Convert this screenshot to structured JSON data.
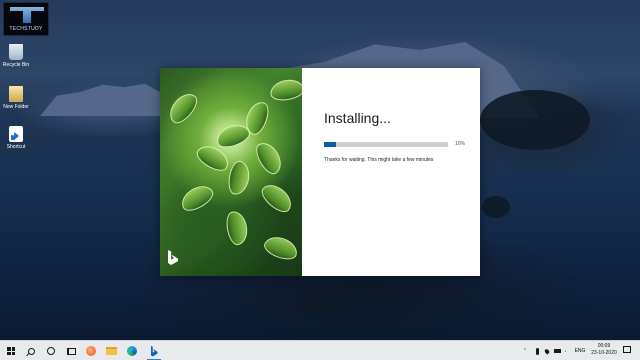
{
  "desktop": {
    "logo_text": "TECHSTUDY",
    "icons": [
      {
        "label": "Recycle Bin",
        "icon": "recycle-bin-icon"
      },
      {
        "label": "New Folder",
        "icon": "folder-icon"
      },
      {
        "label": "Shortcut",
        "icon": "shortcut-icon"
      }
    ]
  },
  "installer": {
    "title": "Installing...",
    "progress_percent_label": "10%",
    "progress_value": 0.1,
    "message": "Thanks for waiting. This might take a few minutes",
    "brand_icon": "bing-icon",
    "accent_color": "#0a5ea8"
  },
  "taskbar": {
    "apps": [
      {
        "name": "start-icon"
      },
      {
        "name": "search-icon"
      },
      {
        "name": "cortana-icon"
      },
      {
        "name": "task-view-icon"
      },
      {
        "name": "app-icon"
      },
      {
        "name": "file-explorer-icon"
      },
      {
        "name": "edge-icon"
      },
      {
        "name": "bing-icon",
        "active": true
      }
    ],
    "language": "ENG",
    "time": "00:09",
    "date": "23-10-2020"
  }
}
